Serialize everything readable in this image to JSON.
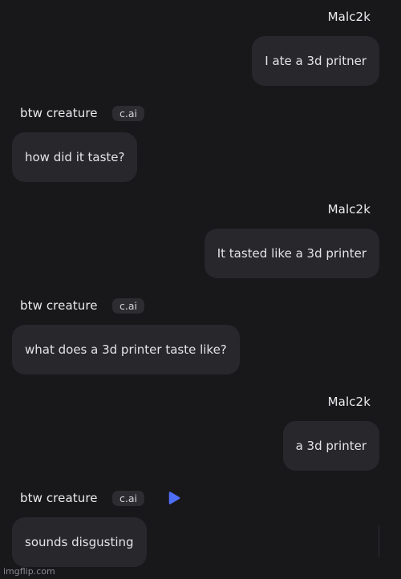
{
  "user_name": "Malc2k",
  "bot_name": "btw creature",
  "bot_badge": "c.ai",
  "messages": [
    {
      "sender": "user",
      "text": "I ate a 3d pritner"
    },
    {
      "sender": "bot",
      "text": "how did it taste?"
    },
    {
      "sender": "user",
      "text": "It tasted like a 3d printer"
    },
    {
      "sender": "bot",
      "text": "what does a 3d printer taste like?"
    },
    {
      "sender": "user",
      "text": "a 3d printer"
    },
    {
      "sender": "bot",
      "text": "sounds disgusting"
    }
  ],
  "icons": {
    "play": "play-icon"
  },
  "colors": {
    "background": "#18181b",
    "bubble": "#27272c",
    "badge": "#2c2c31",
    "accent": "#4f6ef7"
  },
  "watermark": "imgflip.com"
}
